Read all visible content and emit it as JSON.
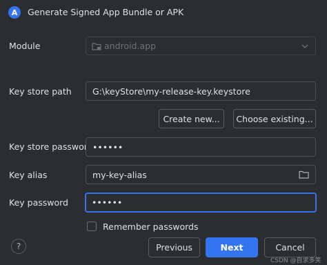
{
  "window": {
    "title": "Generate Signed App Bundle or APK",
    "app_icon_glyph": "A"
  },
  "module": {
    "label": "Module",
    "value": "android.app",
    "icon": "folder-module-icon",
    "dropdown_icon": "chevron-down-icon"
  },
  "key_store_path": {
    "label": "Key store path",
    "value": "G:\\keyStore\\my-release-key.keystore",
    "create_new_label": "Create new...",
    "choose_existing_label": "Choose existing..."
  },
  "key_store_password": {
    "label": "Key store password",
    "value": "••••••"
  },
  "key_alias": {
    "label": "Key alias",
    "value": "my-key-alias",
    "browse_icon": "folder-icon"
  },
  "key_password": {
    "label": "Key password",
    "value": "••••••"
  },
  "remember": {
    "label": "Remember passwords",
    "checked": false
  },
  "footer": {
    "help_glyph": "?",
    "previous_label": "Previous",
    "next_label": "Next",
    "cancel_label": "Cancel"
  },
  "watermark": "CSDN @自求多笑",
  "colors": {
    "background": "#2b2d30",
    "accent": "#3574f0",
    "border": "#4e5157",
    "text": "#dfe1e5"
  }
}
